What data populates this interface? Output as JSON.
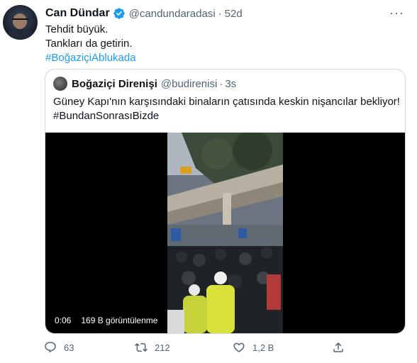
{
  "tweet": {
    "author_name": "Can Dündar",
    "handle": "@candundaradasi",
    "separator": "·",
    "time": "52d",
    "more": "···",
    "lines": [
      "Tehdit büyük.",
      "Tankları da getirin."
    ],
    "hashtag": "#BoğaziçiAblukada"
  },
  "quote": {
    "author_name": "Boğaziçi Direnişi",
    "handle": "@budirenisi",
    "separator": "·",
    "time": "3s",
    "text": "Güney Kapı'nın karşısındaki binaların çatısında keskin nişancılar bekliyor!",
    "hashtag": "#BundanSonrasıBizde",
    "video": {
      "duration": "0:06",
      "views": "169 B görüntülenme"
    }
  },
  "actions": {
    "reply_count": "63",
    "retweet_count": "212",
    "like_count": "1,2 B"
  },
  "colors": {
    "accent": "#1d9bf0",
    "text": "#0f1419",
    "secondary": "#536471",
    "border": "#cfd9de"
  },
  "icons": [
    "verified-badge-icon",
    "more-icon",
    "reply-icon",
    "retweet-icon",
    "like-icon",
    "share-icon"
  ]
}
